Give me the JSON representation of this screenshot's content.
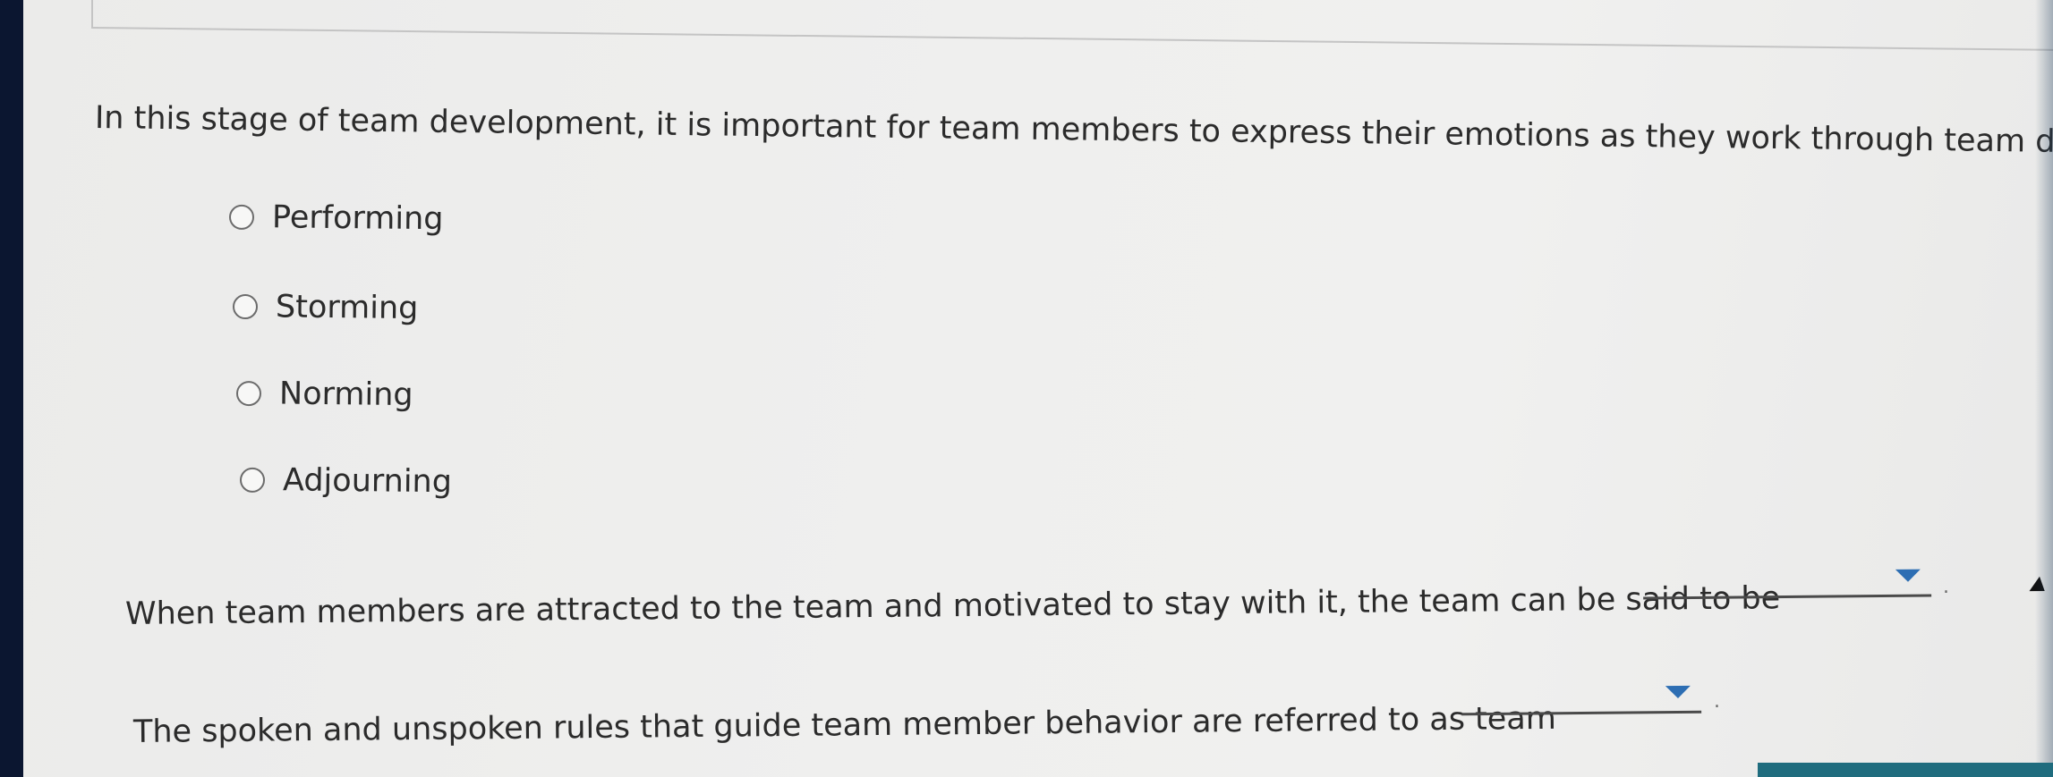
{
  "question1": {
    "prompt": "In this stage of team development, it is important for team members to express their emotions as they work through team differences.",
    "options": [
      {
        "label": "Performing",
        "selected": false
      },
      {
        "label": "Storming",
        "selected": false
      },
      {
        "label": "Norming",
        "selected": false
      },
      {
        "label": "Adjourning",
        "selected": false
      }
    ]
  },
  "question2": {
    "prompt": "When team members are attracted to the team and motivated to stay with it, the team can be said to be",
    "dropdown_value": "",
    "trailing": "."
  },
  "question3": {
    "prompt": "The spoken and unspoken rules that guide team member behavior are referred to as team",
    "dropdown_value": "",
    "trailing": "."
  },
  "colors": {
    "text": "#2b2b2b",
    "dropdown_caret": "#2d6eb3",
    "background": "#efefee"
  },
  "icons": {
    "dropdown": "caret-down-icon",
    "radio": "radio-unchecked-icon",
    "cursor": "mouse-pointer-icon"
  }
}
